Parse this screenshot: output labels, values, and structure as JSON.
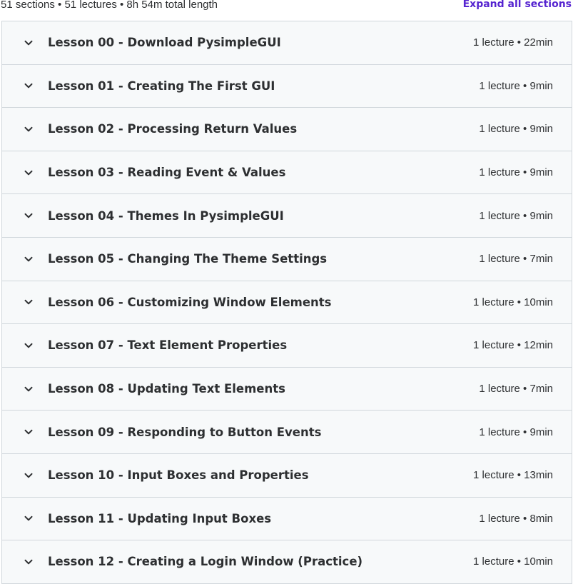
{
  "curriculum": {
    "summary": "51 sections • 51 lectures • 8h 54m total length",
    "expand_all_label": "Expand all sections"
  },
  "icons": {
    "section_toggle": "chevron-down-icon"
  },
  "colors": {
    "accent": "#5624d0",
    "row_background": "#f7f9fa",
    "border": "#d1d7dc",
    "text": "#2d2f31"
  },
  "sections": [
    {
      "title": "Lesson 00 - Download PysimpleGUI",
      "meta": "1 lecture • 22min"
    },
    {
      "title": "Lesson 01 - Creating The First GUI",
      "meta": "1 lecture • 9min"
    },
    {
      "title": "Lesson 02 - Processing Return Values",
      "meta": "1 lecture • 9min"
    },
    {
      "title": "Lesson 03 - Reading Event & Values",
      "meta": "1 lecture • 9min"
    },
    {
      "title": "Lesson 04 - Themes In PysimpleGUI",
      "meta": "1 lecture • 9min"
    },
    {
      "title": "Lesson 05 - Changing The Theme Settings",
      "meta": "1 lecture • 7min"
    },
    {
      "title": "Lesson 06 - Customizing Window Elements",
      "meta": "1 lecture • 10min"
    },
    {
      "title": "Lesson 07 - Text Element Properties",
      "meta": "1 lecture • 12min"
    },
    {
      "title": "Lesson 08 - Updating Text Elements",
      "meta": "1 lecture • 7min"
    },
    {
      "title": "Lesson 09 - Responding to Button Events",
      "meta": "1 lecture • 9min"
    },
    {
      "title": "Lesson 10 - Input Boxes and Properties",
      "meta": "1 lecture • 13min"
    },
    {
      "title": "Lesson 11 - Updating Input Boxes",
      "meta": "1 lecture • 8min"
    },
    {
      "title": "Lesson 12 - Creating a Login Window (Practice)",
      "meta": "1 lecture • 10min"
    }
  ]
}
